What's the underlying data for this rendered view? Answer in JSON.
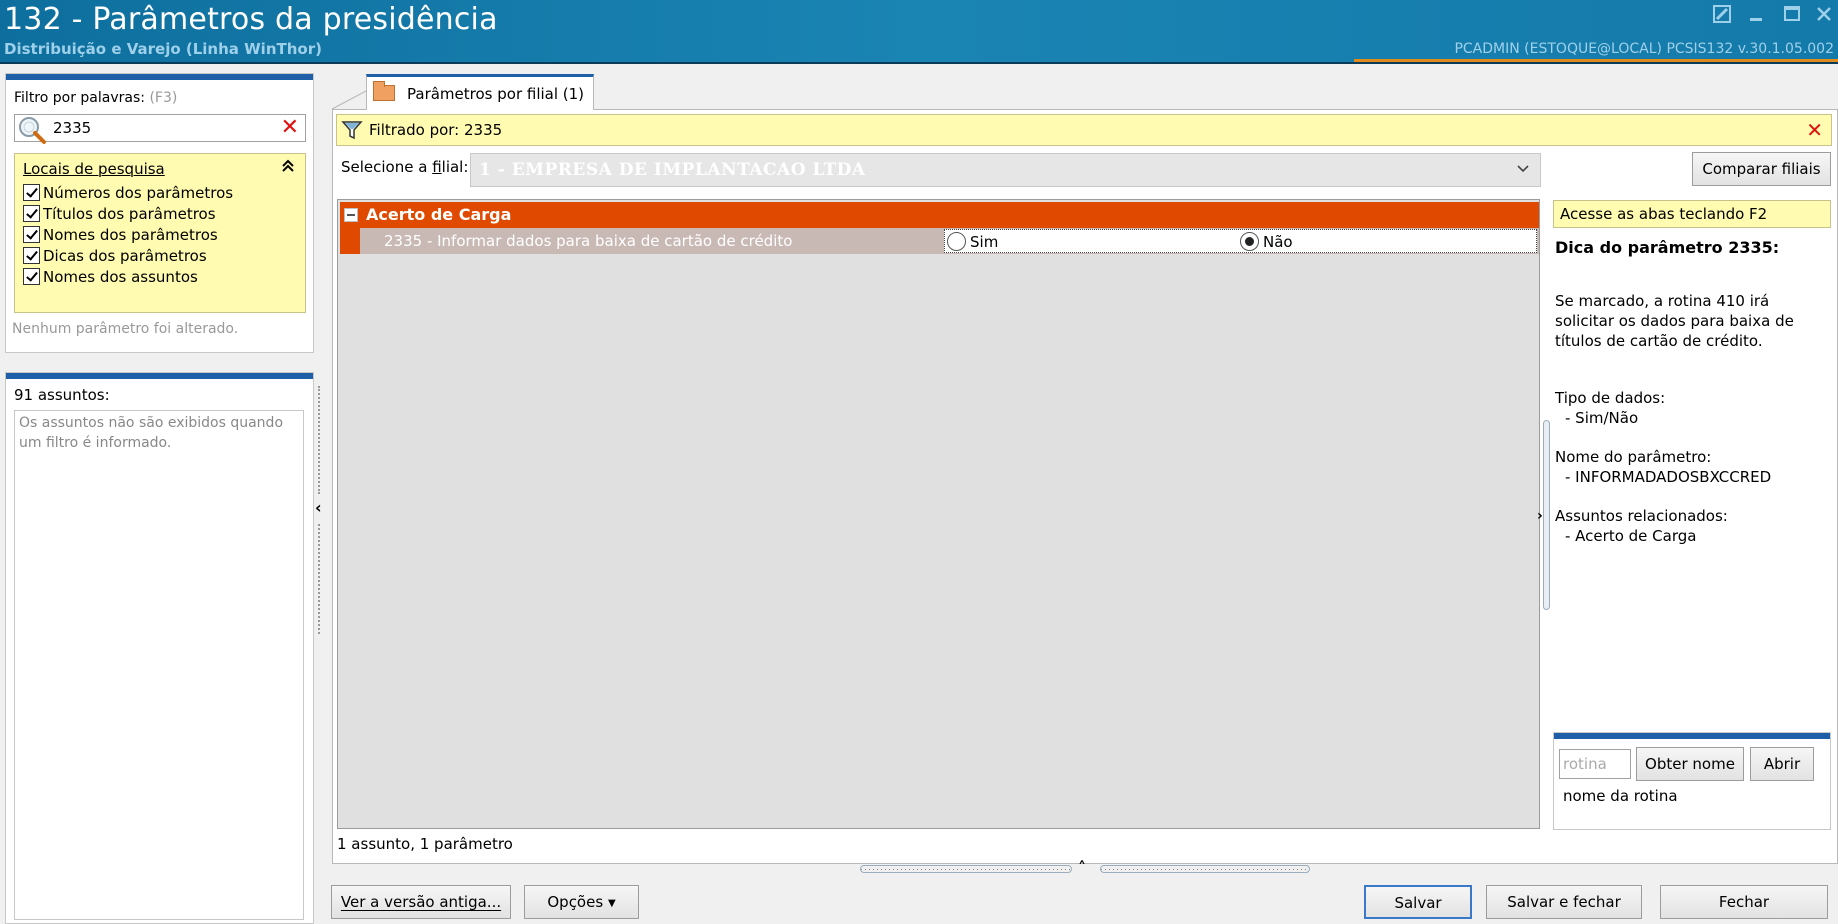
{
  "window": {
    "title": "132 - Parâmetros da presidência",
    "subtitle": "Distribuição e Varejo (Linha WinThor)",
    "user_info": "PCADMIN (ESTOQUE@LOCAL)   PCSIS132  v.30.1.05.002",
    "controls": [
      "edit-icon",
      "minimize-icon",
      "maximize-icon",
      "close-icon"
    ]
  },
  "filter": {
    "label": "Filtro por palavras:",
    "shortcut": "(F3)",
    "value": "2335",
    "locais": {
      "title": "Locais de pesquisa",
      "options": [
        {
          "label": "Números dos parâmetros",
          "checked": true
        },
        {
          "label": "Títulos dos parâmetros",
          "checked": true
        },
        {
          "label": "Nomes dos parâmetros",
          "checked": true
        },
        {
          "label": "Dicas dos parâmetros",
          "checked": true
        },
        {
          "label": "Nomes dos assuntos",
          "checked": true
        }
      ]
    },
    "status": "Nenhum parâmetro foi alterado."
  },
  "assuntos": {
    "label": "91 assuntos:",
    "message": "Os assuntos não são exibidos quando um filtro é informado."
  },
  "tab": {
    "label": "Parâmetros por filial  (1)"
  },
  "filtered": {
    "text": "Filtrado por: 2335"
  },
  "filial": {
    "label": "Selecione a filial:",
    "value": "1 - EMPRESA DE IMPLANTACAO LTDA",
    "compare_button": "Comparar filiais"
  },
  "grid": {
    "group": "Acerto de Carga",
    "rows": [
      {
        "text": "2335 - Informar dados para baixa de cartão de crédito",
        "options": [
          "Sim",
          "Não"
        ],
        "selected": "Não"
      }
    ],
    "status": "1 assunto, 1 parâmetro"
  },
  "info": {
    "f2_hint": "Acesse as abas teclando F2",
    "dica_title": "Dica do parâmetro 2335:",
    "dica_text": "Se marcado, a rotina 410 irá solicitar os dados para baixa de títulos de cartão de crédito.",
    "tipo_label": "Tipo de dados:",
    "tipo_value": "- Sim/Não",
    "nome_label": "Nome do parâmetro:",
    "nome_value": "- INFORMADADOSBXCCRED",
    "assuntos_label": "Assuntos relacionados:",
    "assuntos_value": "- Acerto de Carga"
  },
  "rotina": {
    "placeholder": "rotina",
    "obter_button": "Obter nome",
    "abrir_button": "Abrir",
    "name_text": "nome da rotina"
  },
  "footer": {
    "old_version_button": "Ver a versão antiga...",
    "options_button": "Opções",
    "save_button": "Salvar",
    "save_close_button": "Salvar e fechar",
    "close_button": "Fechar"
  }
}
